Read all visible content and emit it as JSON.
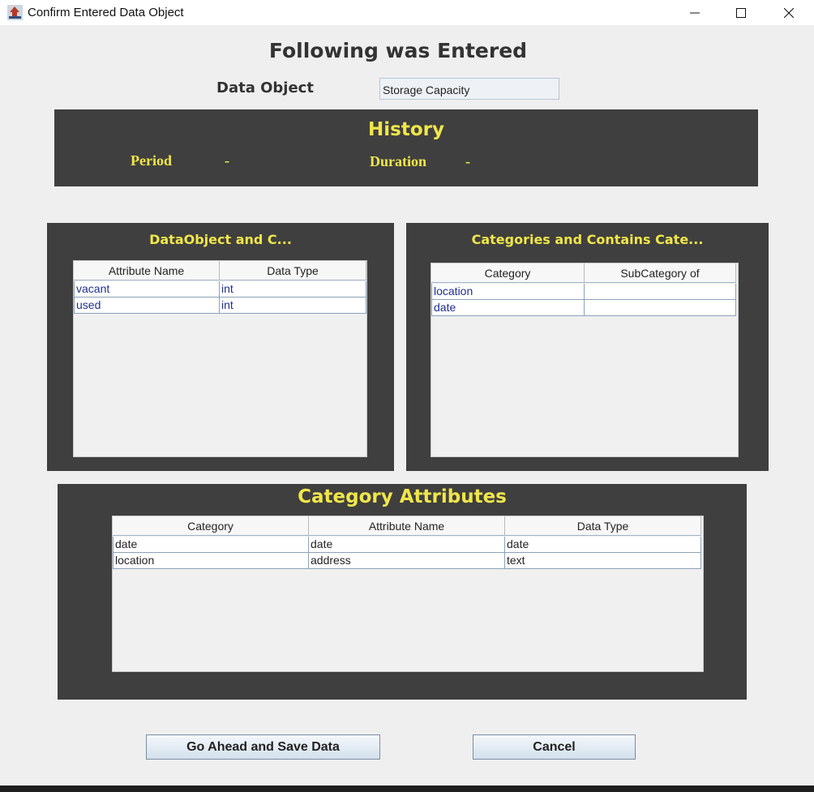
{
  "window": {
    "title": "Confirm Entered Data Object"
  },
  "heading": "Following was Entered",
  "data_object": {
    "label": "Data Object",
    "value": "Storage Capacity"
  },
  "history": {
    "title": "History",
    "period_label": "Period",
    "period_value": "-",
    "duration_label": "Duration",
    "duration_value": "-"
  },
  "attributes_panel": {
    "title": "DataObject and C...",
    "columns": [
      "Attribute Name",
      "Data Type"
    ],
    "rows": [
      [
        "vacant",
        "int"
      ],
      [
        "used",
        "int"
      ]
    ]
  },
  "categories_panel": {
    "title": "Categories and Contains Cate...",
    "columns": [
      "Category",
      "SubCategory of"
    ],
    "rows": [
      [
        "location",
        ""
      ],
      [
        "date",
        ""
      ]
    ]
  },
  "category_attributes_panel": {
    "title": "Category Attributes",
    "columns": [
      "Category",
      "Attribute Name",
      "Data Type"
    ],
    "rows": [
      [
        "date",
        "date",
        "date"
      ],
      [
        "location",
        "address",
        "text"
      ]
    ]
  },
  "buttons": {
    "save": "Go Ahead and Save Data",
    "cancel": "Cancel"
  },
  "colors": {
    "panel_bg": "#3f3f3f",
    "panel_title": "#f0e64a",
    "window_bg": "#efefef"
  }
}
